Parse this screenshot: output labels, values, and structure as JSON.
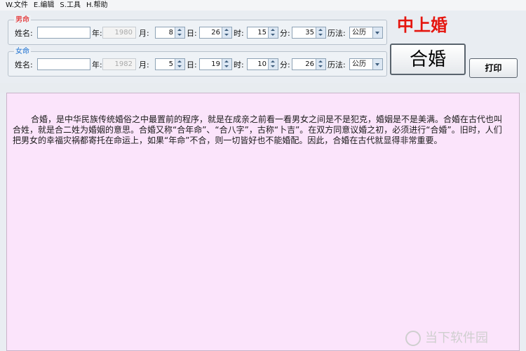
{
  "menu": [
    "W.文件",
    "E.编辑",
    "S.工具",
    "H.帮助"
  ],
  "male": {
    "legend": "男命",
    "name_label": "姓名:",
    "name_value": "",
    "year_label": "年:",
    "year": "1980",
    "month_label": "月:",
    "month": "8",
    "day_label": "日:",
    "day": "26",
    "hour_label": "时:",
    "hour": "15",
    "minute_label": "分:",
    "minute": "35",
    "calendar_label": "历法:",
    "calendar": "公历"
  },
  "female": {
    "legend": "女命",
    "name_label": "姓名:",
    "name_value": "",
    "year_label": "年:",
    "year": "1982",
    "month_label": "月:",
    "month": "5",
    "day_label": "日:",
    "day": "19",
    "hour_label": "时:",
    "hour": "10",
    "minute_label": "分:",
    "minute": "26",
    "calendar_label": "历法:",
    "calendar": "公历"
  },
  "result": "中上婚",
  "buttons": {
    "match": "合婚",
    "print": "打印"
  },
  "description": "合婚，是中华民族传统婚俗之中最置前的程序，就是在成亲之前看一看男女之间是不是犯克，婚姻是不是美满。合婚在古代也叫合姓，就是合二姓为婚姻的意思。合婚又称“合年命”、“合八字”，古称“卜吉”。在双方同意议婚之初，必须进行“合婚”。旧时，人们把男女的幸福灾祸都寄托在命运上，如果“年命”不合，则一切皆好也不能婚配。因此，合婚在古代就显得非常重要。",
  "watermark": "当下软件园",
  "colors": {
    "legend_male": "#e00000",
    "legend_female": "#1a6fd0",
    "result": "#e5160f",
    "content_bg": "#fbe4fb"
  }
}
